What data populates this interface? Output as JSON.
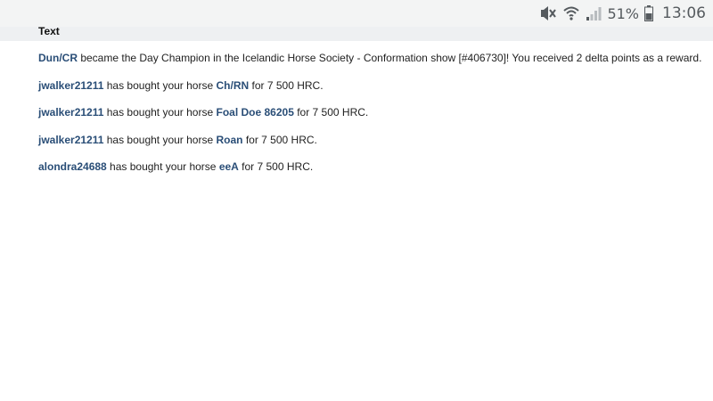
{
  "status_bar": {
    "battery_percent": "51%",
    "time": "13:06",
    "icons": [
      "mute-icon",
      "wifi-icon",
      "signal-icon",
      "battery-icon"
    ],
    "colors": {
      "icon": "#555a5e",
      "background": "#f3f4f4"
    }
  },
  "table": {
    "column_header": "Text",
    "rows": [
      {
        "link": "Dun/CR",
        "text": " became the Day Champion in the Icelandic Horse Society - Conformation show [#406730]! You received 2 delta points as a reward."
      },
      {
        "user": "jwalker21211",
        "middle": " has bought your horse ",
        "horse": "Ch/RN",
        "end": " for 7 500 HRC."
      },
      {
        "user": "jwalker21211",
        "middle": " has bought your horse ",
        "horse": "Foal Doe 86205",
        "end": " for 7 500 HRC."
      },
      {
        "user": "jwalker21211",
        "middle": " has bought your horse ",
        "horse": "Roan",
        "end": " for 7 500 HRC."
      },
      {
        "user": "alondra24688",
        "middle": " has bought your horse ",
        "horse": "eeA",
        "end": " for 7 500 HRC."
      }
    ]
  },
  "colors": {
    "link": "#2a4e77",
    "text": "#222222"
  }
}
